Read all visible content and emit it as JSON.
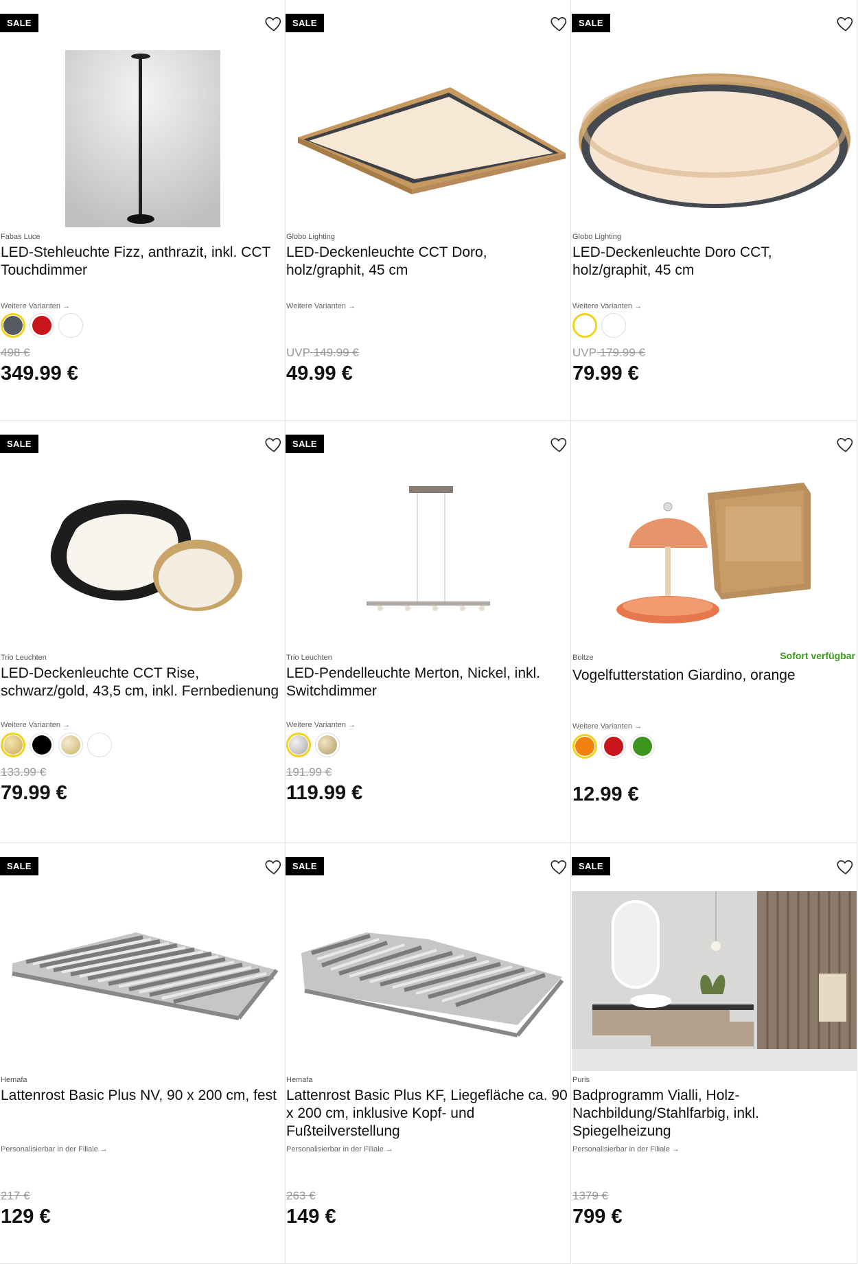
{
  "sale_label": "SALE",
  "variants_label": "Weitere Varianten →",
  "perso_label": "Personalisierbar in der Filiale →",
  "availability": "Sofort verfügbar",
  "colors": {
    "brand_black": "#000000",
    "sold_out_gray": "#999999",
    "available_green": "#3a9a1b",
    "selected_ring": "#f2d21c"
  },
  "products": [
    {
      "brand": "Fabas Luce",
      "title": "LED-Stehleuchte Fizz, anthrazit, inkl. CCT Touchdimmer",
      "old_price": "498 €",
      "price": "349.99 €"
    },
    {
      "brand": "Globo Lighting",
      "title": "LED-Deckenleuchte CCT Doro, holz/graphit, 45 cm",
      "old_price": "149.99 €",
      "uvp": "UVP",
      "price": "49.99 €"
    },
    {
      "brand": "Globo Lighting",
      "title": "LED-Deckenleuchte Doro CCT, holz/graphit, 45 cm",
      "old_price": "179.99 €",
      "uvp": "UVP",
      "price": "79.99 €"
    },
    {
      "brand": "Trio Leuchten",
      "title": "LED-Deckenleuchte CCT Rise, schwarz/gold, 43,5 cm, inkl. Fernbedienung",
      "old_price": "133.99 €",
      "price": "79.99 €"
    },
    {
      "brand": "Trio Leuchten",
      "title": "LED-Pendelleuchte Merton, Nickel, inkl. Switchdimmer",
      "old_price": "191.99 €",
      "price": "119.99 €"
    },
    {
      "brand": "Boltze",
      "title": "Vogelfutterstation Giardino, orange",
      "price": "12.99 €"
    },
    {
      "brand": "Hemafa",
      "title": "Lattenrost Basic Plus NV, 90 x 200 cm, fest",
      "old_price": "217 €",
      "price": "129 €"
    },
    {
      "brand": "Hemafa",
      "title": "Lattenrost Basic Plus KF, Liegefläche ca. 90 x 200 cm, inklusive Kopf- und Fußteilverstellung",
      "old_price": "263 €",
      "price": "149 €"
    },
    {
      "brand": "Puris",
      "title": "Badprogramm Vialli, Holz-Nachbildung/Stahlfarbig, inkl. Spiegelheizung",
      "old_price": "1379 €",
      "price": "799 €"
    }
  ],
  "icons": {
    "favorite": "heart-icon"
  }
}
